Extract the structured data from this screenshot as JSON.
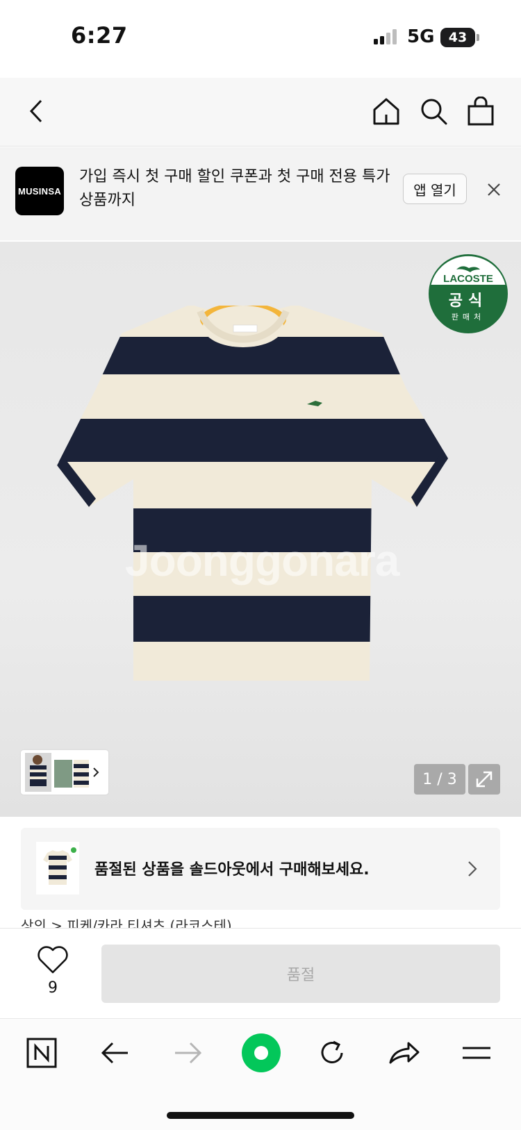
{
  "status_bar": {
    "time": "6:27",
    "network": "5G",
    "battery": "43"
  },
  "banner": {
    "logo_text": "MUSINSA",
    "message": "가입 즉시 첫 구매 할인 쿠폰과 첫 구매 전용 특가 상품까지",
    "open_app_label": "앱 열기"
  },
  "product": {
    "badge": {
      "brand": "LACOSTE",
      "line1": "공식",
      "line2": "판매처"
    },
    "watermark": "Joonggonara",
    "page_indicator": "1 / 3"
  },
  "soldout": {
    "message": "품절된 상품을 솔드아웃에서 구매해보세요."
  },
  "breadcrumb": "상의 > 피케/카라 티셔츠 (라코스테)",
  "actions": {
    "like_count": "9",
    "buy_label": "품절"
  },
  "icons": {
    "back": "chevron-left-icon",
    "home": "home-icon",
    "search": "search-icon",
    "cart": "shopping-bag-icon",
    "close": "close-icon",
    "expand": "expand-icon",
    "heart": "heart-icon",
    "toolbar": [
      "naver-n-icon",
      "arrow-left-icon",
      "arrow-right-icon",
      "green-dot-icon",
      "refresh-icon",
      "share-icon",
      "menu-icon"
    ]
  },
  "colors": {
    "stripe_navy": "#1b2238",
    "stripe_cream": "#f1ead9",
    "collar_yellow": "#f3b53b",
    "lacoste_green": "#1f6e3b",
    "naver_green": "#03c75a"
  }
}
